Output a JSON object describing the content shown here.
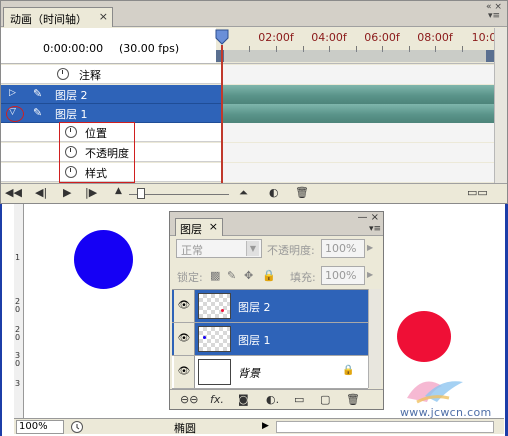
{
  "animation_panel": {
    "tab_title": "动画（时间轴）",
    "tab_close": "×",
    "current_time": "0:00:00:00",
    "fps": "(30.00 fps)",
    "ruler_ticks": [
      "02:00f",
      "04:00f",
      "06:00f",
      "08:00f",
      "10:0"
    ],
    "rows": [
      {
        "label": "注释",
        "selected": false
      },
      {
        "label": "图层 2",
        "selected": true,
        "expand_icon": "triangle-right-icon"
      },
      {
        "label": "图层 1",
        "selected": true,
        "expand_icon": "triangle-down-icon"
      },
      {
        "label": "位置",
        "selected": false
      },
      {
        "label": "不透明度",
        "selected": false
      },
      {
        "label": "样式",
        "selected": false
      }
    ],
    "footer_buttons": [
      "first-frame",
      "prev-frame",
      "play",
      "next-frame",
      "zoom-out",
      "zoom-in",
      "tween",
      "delete",
      "convert-to-frames"
    ]
  },
  "canvas": {
    "circle_colors": {
      "blue": "#1500f5",
      "red": "#ef0f36"
    },
    "vruler_labels": [
      "1",
      "2",
      "0",
      "2",
      "0",
      "3",
      "0",
      "3"
    ],
    "watermark": "www.jcwcn.com"
  },
  "status_bar": {
    "zoom": "100%",
    "tool": "椭圆"
  },
  "layers_panel": {
    "tab_title": "图层",
    "tab_close": "×",
    "blend_mode": "正常",
    "opacity_label": "不透明度:",
    "opacity_value": "100%",
    "lock_label": "锁定:",
    "fill_label": "填充:",
    "fill_value": "100%",
    "layers": [
      {
        "name": "图层 2",
        "selected": true,
        "thumb_dot": "#ef0f36"
      },
      {
        "name": "图层 1",
        "selected": true,
        "thumb_dot": "#1500f5"
      },
      {
        "name": "背景",
        "selected": false,
        "locked": true
      }
    ],
    "footer_icons": [
      "link-icon",
      "fx-icon",
      "mask-icon",
      "adjustment-icon",
      "group-folder-icon",
      "new-layer-icon",
      "trash-icon"
    ]
  }
}
